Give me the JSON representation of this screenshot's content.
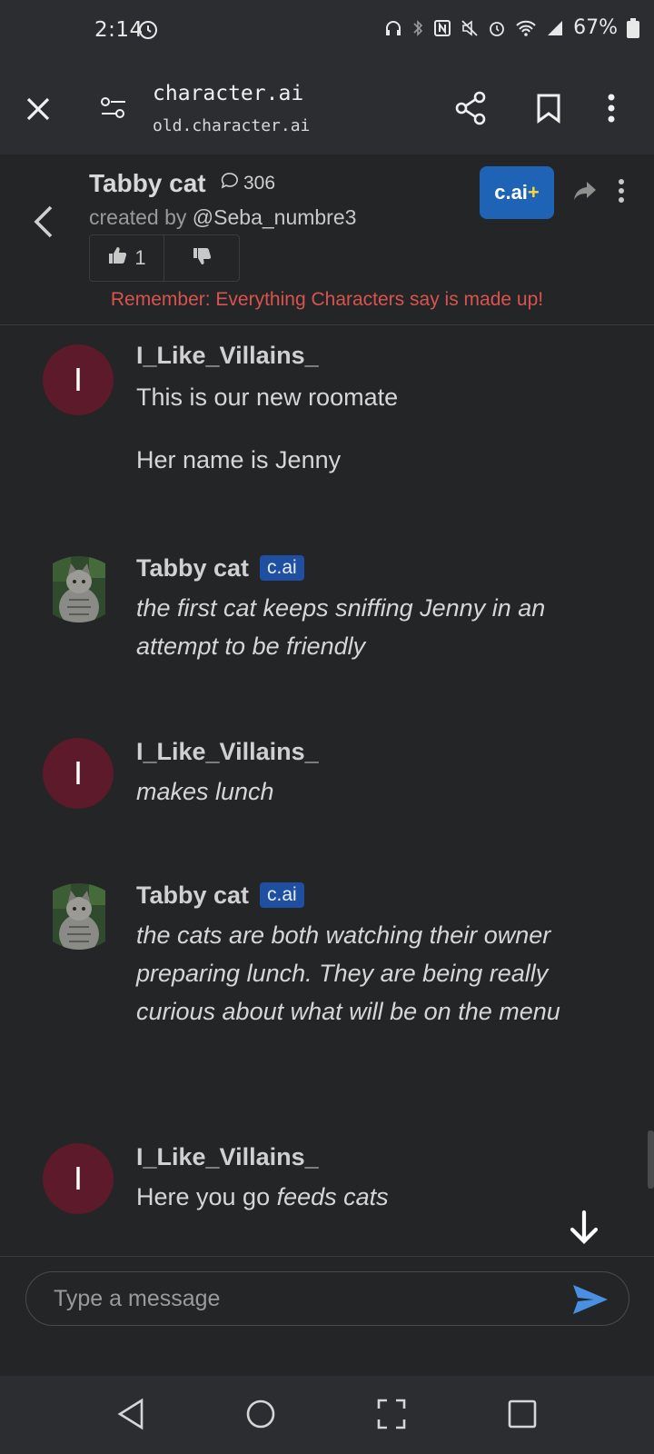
{
  "status_bar": {
    "time": "2:14",
    "battery": "67%"
  },
  "browser": {
    "title": "character.ai",
    "url": "old.character.ai"
  },
  "character": {
    "name": "Tabby cat",
    "chat_count": "306",
    "created_by_prefix": "created by",
    "creator_handle": "@Seba_numbre3",
    "likes": "1",
    "plus_badge": "c.ai",
    "plus_sign": "+"
  },
  "disclaimer": "Remember: Everything Characters say is made up!",
  "messages": [
    {
      "author": "I_Like_Villains_",
      "avatar_letter": "I",
      "lines": [
        "This is our new roomate",
        "Her name is Jenny"
      ]
    },
    {
      "author": "Tabby cat",
      "badge": "c.ai",
      "text": "the first cat keeps sniffing Jenny in an attempt to be friendly"
    },
    {
      "author": "I_Like_Villains_",
      "avatar_letter": "I",
      "text": "makes lunch"
    },
    {
      "author": "Tabby cat",
      "badge": "c.ai",
      "text": "the cats are both watching their owner preparing lunch. They are being really curious about what will be on the menu"
    },
    {
      "author": "I_Like_Villains_",
      "avatar_letter": "I",
      "text_plain": "Here you go",
      "text_italic": "feeds cats"
    }
  ],
  "composer": {
    "placeholder": "Type a message"
  },
  "colors": {
    "accent": "#1f63b6",
    "user_avatar": "#5c1a2a",
    "disclaimer": "#d9534f",
    "send": "#4a90e2"
  }
}
